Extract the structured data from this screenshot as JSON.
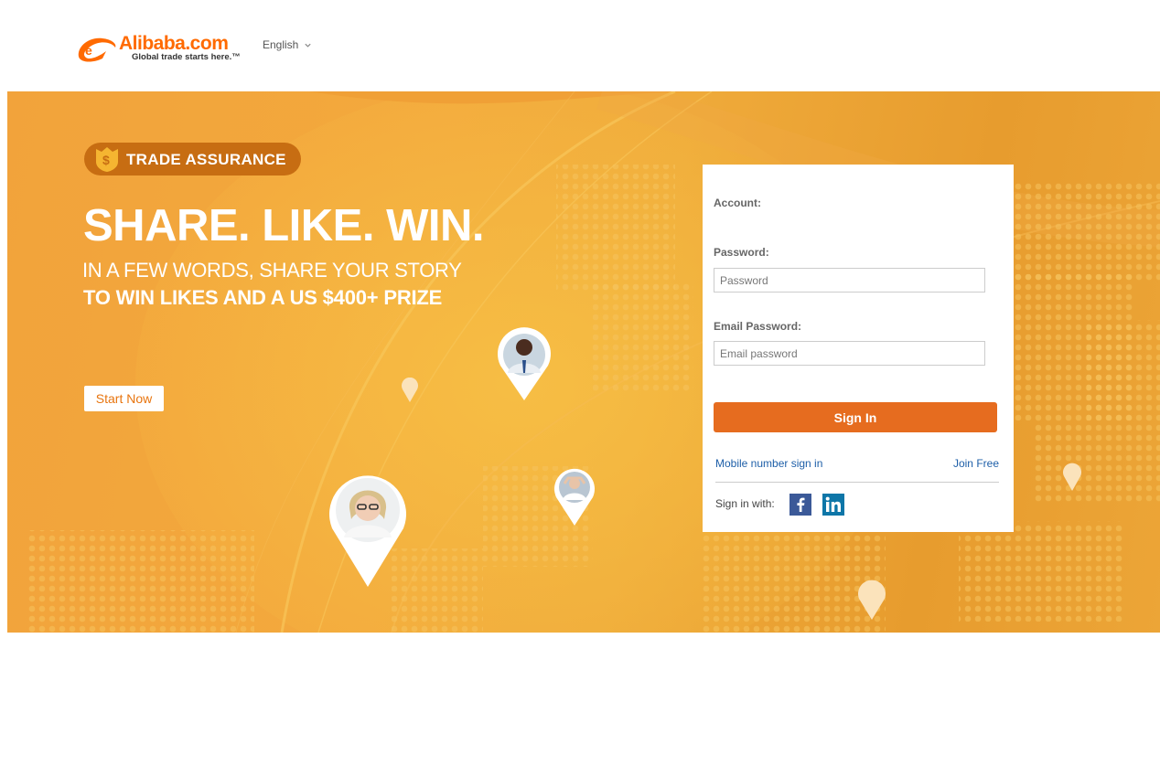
{
  "header": {
    "logo_text": "Alibaba.com",
    "logo_tagline": "Global trade starts here.™",
    "language": "English"
  },
  "banner": {
    "badge_label": "TRADE ASSURANCE",
    "headline": "SHARE. LIKE. WIN.",
    "subline_1": "IN A FEW WORDS, SHARE YOUR STORY",
    "subline_2": "TO WIN LIKES AND A US $400+ PRIZE",
    "cta_label": "Start Now"
  },
  "login": {
    "account_label": "Account:",
    "password_label": "Password:",
    "password_placeholder": "Password",
    "email_password_label": "Email Password:",
    "email_password_placeholder": "Email password",
    "sign_in_label": "Sign In",
    "mobile_link": "Mobile number sign in",
    "join_link": "Join Free",
    "sign_in_with": "Sign in with:",
    "social": [
      "facebook-icon",
      "linkedin-icon"
    ]
  },
  "colors": {
    "brand_orange": "#ff6a00",
    "button_orange": "#e66c1f",
    "link_blue": "#1e5fa8",
    "badge_brown": "#c76d12"
  }
}
